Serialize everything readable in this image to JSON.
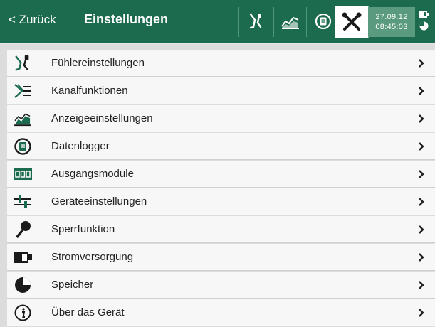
{
  "header": {
    "back_label": "< Zurück",
    "title": "Einstellungen",
    "date": "27.09.12",
    "time": "08:45:03",
    "colors": {
      "bar": "#1c6b4e",
      "accent": "#1c6b4e",
      "clock_bg": "#5a9a7e"
    },
    "tool_icons": [
      "probe-icon",
      "chart-icon",
      "datalogger-icon",
      "settings-tools-icon"
    ],
    "active_tool": "settings-tools-icon",
    "status_icons": [
      "battery-icon",
      "memory-icon"
    ]
  },
  "menu": {
    "items": [
      {
        "label": "Fühlereinstellungen",
        "icon": "probe-icon"
      },
      {
        "label": "Kanalfunktionen",
        "icon": "channel-functions-icon"
      },
      {
        "label": "Anzeigeeinstellungen",
        "icon": "chart-icon"
      },
      {
        "label": "Datenlogger",
        "icon": "datalogger-icon"
      },
      {
        "label": "Ausgangsmodule",
        "icon": "output-modules-icon"
      },
      {
        "label": "Geräteeinstellungen",
        "icon": "sliders-icon"
      },
      {
        "label": "Sperrfunktion",
        "icon": "key-icon"
      },
      {
        "label": "Stromversorgung",
        "icon": "battery-icon"
      },
      {
        "label": "Speicher",
        "icon": "memory-icon"
      },
      {
        "label": "Über das Gerät",
        "icon": "info-icon"
      }
    ]
  }
}
